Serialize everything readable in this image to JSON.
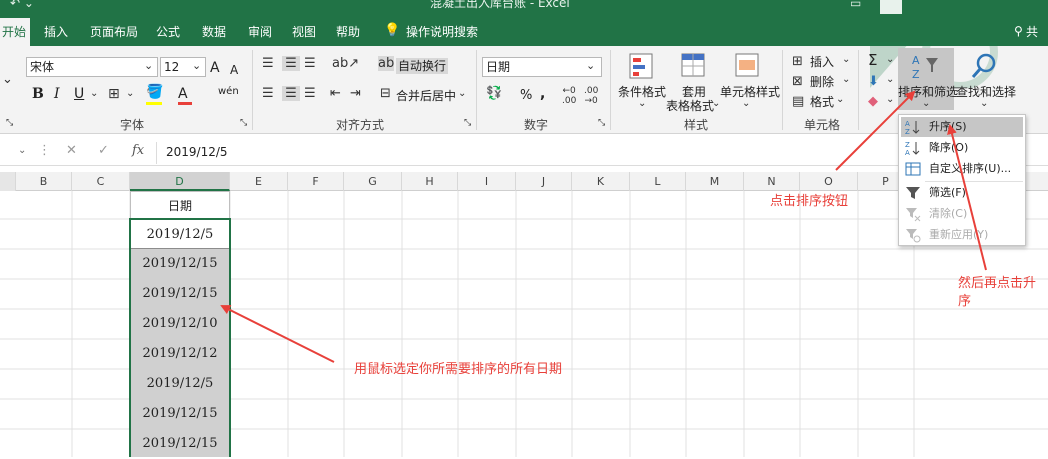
{
  "window": {
    "title": "混凝土出入库台账  -  Excel"
  },
  "tabs": [
    {
      "label": "开始",
      "active": true
    },
    {
      "label": "插入"
    },
    {
      "label": "页面布局"
    },
    {
      "label": "公式"
    },
    {
      "label": "数据"
    },
    {
      "label": "审阅"
    },
    {
      "label": "视图"
    },
    {
      "label": "帮助"
    },
    {
      "label": "操作说明搜索"
    },
    {
      "label": "共"
    }
  ],
  "ribbon": {
    "font": {
      "name": "宋体",
      "size": "12",
      "label": "字体",
      "bold": "B",
      "italic": "I",
      "underline": "U",
      "grow": "A",
      "shrink": "A",
      "font_color": "A",
      "phonetic": "wén"
    },
    "align": {
      "wrap": "自动换行",
      "merge": "合并后居中",
      "label": "对齐方式"
    },
    "number": {
      "format": "日期",
      "percent": "%",
      "comma": ",",
      "label": "数字"
    },
    "styles": {
      "conditional": "条件格式",
      "table1": "套用",
      "table2": "表格格式",
      "cell_styles": "单元格样式",
      "label": "样式"
    },
    "cells": {
      "insert": "插入",
      "delete": "删除",
      "format": "格式",
      "label": "单元格"
    },
    "editing": {
      "sum": "Σ",
      "sort_filter": "排序和筛选",
      "find_select": "查找和选择"
    }
  },
  "formula_bar": {
    "fx": "fx",
    "value": "2019/12/5"
  },
  "columns": [
    "B",
    "C",
    "D",
    "E",
    "F",
    "G",
    "H",
    "I",
    "J",
    "K",
    "L",
    "M",
    "N",
    "O",
    "P"
  ],
  "cells": [
    "日期",
    "2019/12/5",
    "2019/12/15",
    "2019/12/15",
    "2019/12/10",
    "2019/12/12",
    "2019/12/5",
    "2019/12/15",
    "2019/12/15"
  ],
  "dropdown": [
    {
      "label": "升序(S)",
      "icon": "sort-ascending-icon",
      "highlight": true
    },
    {
      "label": "降序(O)",
      "icon": "sort-descending-icon"
    },
    {
      "label": "自定义排序(U)...",
      "icon": "custom-sort-icon"
    },
    {
      "label": "筛选(F)",
      "icon": "filter-icon"
    },
    {
      "label": "清除(C)",
      "icon": "clear-filter-icon",
      "disabled": true
    },
    {
      "label": "重新应用(Y)",
      "icon": "reapply-icon",
      "disabled": true
    }
  ],
  "annotations": {
    "click_sort": "点击排序按钮",
    "then_ascending_1": "然后再点击升",
    "then_ascending_2": "序",
    "select_dates": "用鼠标选定你所需要排序的所有日期"
  },
  "colors": {
    "accent": "#217346",
    "annotation": "#e8403a",
    "selection_fill": "#d0d0d0"
  }
}
